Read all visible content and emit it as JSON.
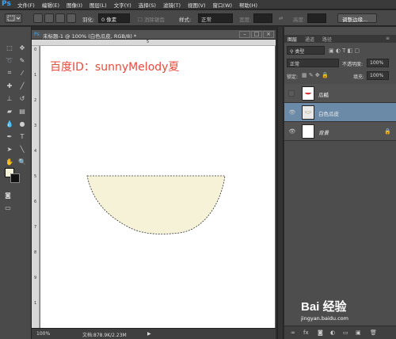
{
  "app": {
    "logo": "Ps"
  },
  "menu": [
    "文件(F)",
    "编辑(E)",
    "图像(I)",
    "图层(L)",
    "文字(Y)",
    "选择(S)",
    "滤镜(T)",
    "视图(V)",
    "窗口(W)",
    "帮助(H)"
  ],
  "options": {
    "feather_label": "羽化:",
    "feather_value": "0 像素",
    "antialias_label": "消除锯齿",
    "style_label": "样式:",
    "style_value": "正常",
    "width_label": "宽度:",
    "height_label": "高度:",
    "refine_edge_button": "调整边缘..."
  },
  "document": {
    "tab_title": "未标题-1 @ 100% (白色瓜皮, RGB/8) *",
    "watermark_text": "百度ID：sunnyMelody夏",
    "zoom": "100%",
    "doc_info": "文档:878.9K/2.23M",
    "ruler_top": [
      "5"
    ],
    "ruler_left": [
      "0",
      "1",
      "2",
      "3",
      "4",
      "5",
      "6",
      "7",
      "8",
      "9",
      "1"
    ]
  },
  "panel": {
    "tabs": [
      "图层",
      "通道",
      "路径"
    ],
    "kind_filter": "类型",
    "blend_mode": "正常",
    "opacity_label": "不透明度:",
    "opacity_value": "100%",
    "lock_label": "锁定:",
    "fill_label": "填充:",
    "fill_value": "100%",
    "layers": [
      {
        "name": "瓜瓤",
        "visible": false,
        "selected": false
      },
      {
        "name": "白色瓜皮",
        "visible": true,
        "selected": true
      },
      {
        "name": "背景",
        "visible": true,
        "selected": false,
        "locked": true
      }
    ]
  },
  "branding": {
    "logo": "Bai  经验",
    "url": "jingyan.baidu.com"
  },
  "colors": {
    "foreground": "#f5f2da",
    "background": "#111111",
    "selection_fill": "#f5f2d8",
    "watermark": "#e84b3c",
    "selected_layer": "#6b8aa8"
  }
}
